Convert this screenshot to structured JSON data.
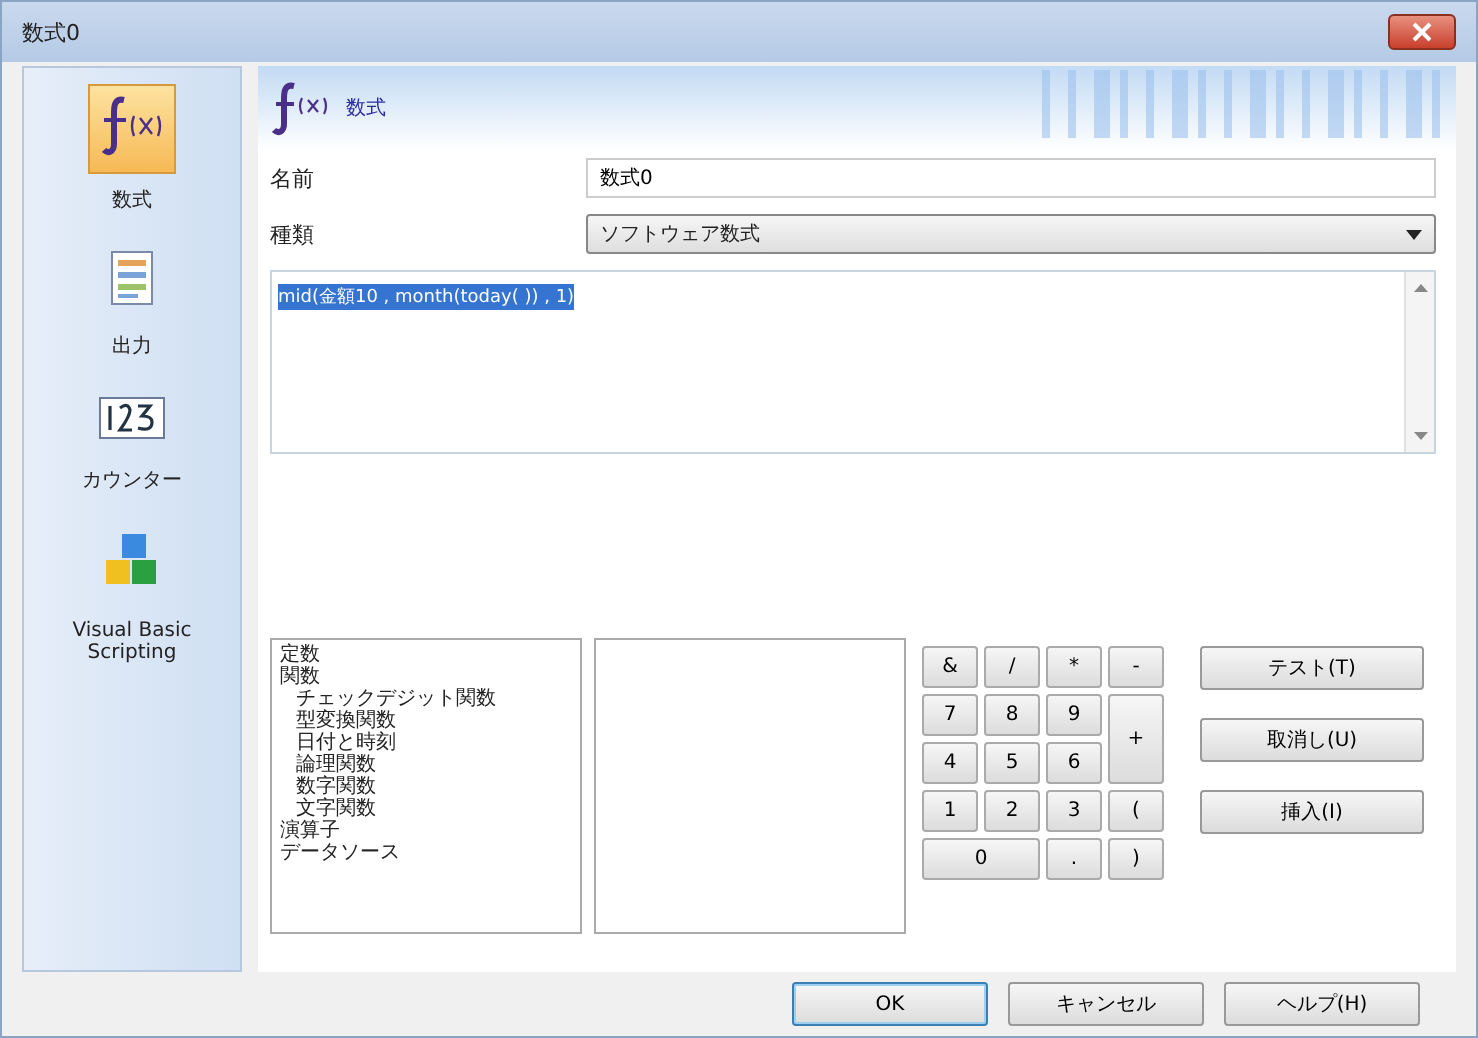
{
  "window": {
    "title": "数式0"
  },
  "sidebar": {
    "items": [
      {
        "label": "数式",
        "kind": "formula",
        "selected": true
      },
      {
        "label": "出力",
        "kind": "output",
        "selected": false
      },
      {
        "label": "カウンター",
        "kind": "counter",
        "selected": false
      },
      {
        "label": "Visual Basic Scripting",
        "kind": "script",
        "selected": false
      }
    ]
  },
  "header": {
    "title": "数式"
  },
  "form": {
    "name_label": "名前",
    "name_value": "数式0",
    "type_label": "種類",
    "type_value": "ソフトウェア数式"
  },
  "formula": {
    "value": "mid(金額10 , month(today( )) , 1)"
  },
  "tree": [
    {
      "label": "定数"
    },
    {
      "label": "関数",
      "children": [
        {
          "label": "チェックデジット関数"
        },
        {
          "label": "型変換関数"
        },
        {
          "label": "日付と時刻"
        },
        {
          "label": "論理関数"
        },
        {
          "label": "数字関数"
        },
        {
          "label": "文字関数"
        }
      ]
    },
    {
      "label": "演算子"
    },
    {
      "label": "データソース"
    }
  ],
  "keypad": [
    {
      "label": "&",
      "kind": "key"
    },
    {
      "label": "/",
      "kind": "key"
    },
    {
      "label": "*",
      "kind": "key"
    },
    {
      "label": "-",
      "kind": "key"
    },
    {
      "label": "7",
      "kind": "key"
    },
    {
      "label": "8",
      "kind": "key"
    },
    {
      "label": "9",
      "kind": "key"
    },
    {
      "label": "+",
      "kind": "tall"
    },
    {
      "label": "4",
      "kind": "key"
    },
    {
      "label": "5",
      "kind": "key"
    },
    {
      "label": "6",
      "kind": "key"
    },
    {
      "label": "1",
      "kind": "key"
    },
    {
      "label": "2",
      "kind": "key"
    },
    {
      "label": "3",
      "kind": "key"
    },
    {
      "label": "(",
      "kind": "key"
    },
    {
      "label": "0",
      "kind": "wide"
    },
    {
      "label": ".",
      "kind": "key"
    },
    {
      "label": ")",
      "kind": "key"
    }
  ],
  "side_buttons": [
    "テスト(T)",
    "取消し(U)",
    "挿入(I)"
  ],
  "footer_buttons": [
    {
      "label": "OK",
      "default": true
    },
    {
      "label": "キャンセル",
      "default": false
    },
    {
      "label": "ヘルプ(H)",
      "default": false
    }
  ]
}
